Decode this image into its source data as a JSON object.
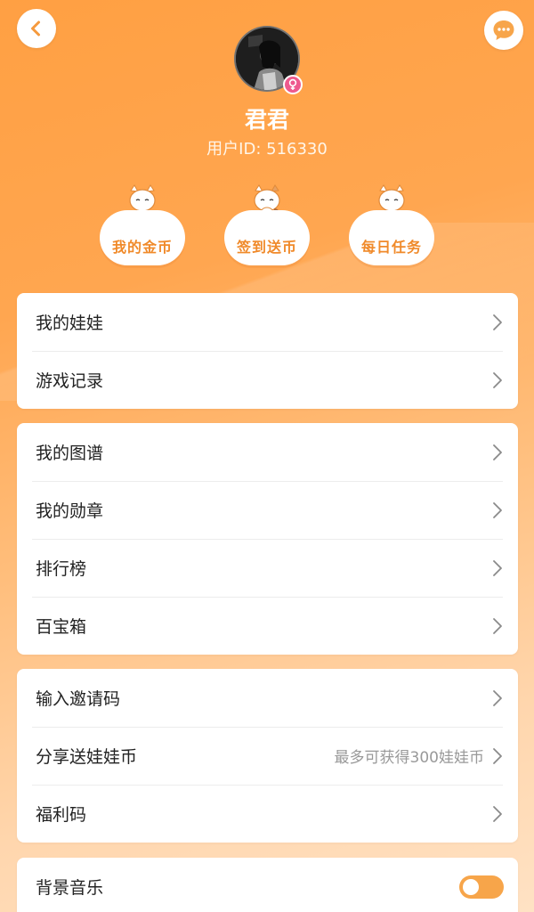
{
  "profile": {
    "name": "君君",
    "user_id": "用户ID: 516330",
    "gender": "female"
  },
  "features": [
    {
      "label": "我的金币",
      "icon": "lucky-cat-coin-icon"
    },
    {
      "label": "签到送币",
      "icon": "lucky-cat-checkin-icon"
    },
    {
      "label": "每日任务",
      "icon": "lucky-cat-task-icon"
    }
  ],
  "menu_group1": [
    {
      "label": "我的娃娃"
    },
    {
      "label": "游戏记录"
    }
  ],
  "menu_group2": [
    {
      "label": "我的图谱"
    },
    {
      "label": "我的勋章"
    },
    {
      "label": "排行榜"
    },
    {
      "label": "百宝箱"
    }
  ],
  "menu_group3": [
    {
      "label": "输入邀请码",
      "hint": ""
    },
    {
      "label": "分享送娃娃币",
      "hint": "最多可获得300娃娃币"
    },
    {
      "label": "福利码",
      "hint": ""
    }
  ],
  "settings": {
    "bg_music_label": "背景音乐",
    "bg_music_on": true
  },
  "colors": {
    "accent": "#f7a54a",
    "header_orange": "#ffa043",
    "gender_pink": "#ee5a8e"
  }
}
